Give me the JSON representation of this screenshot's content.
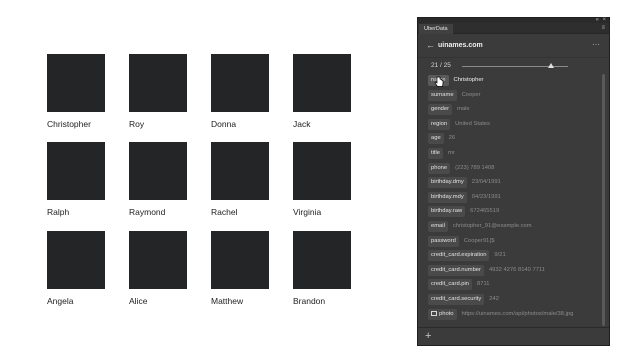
{
  "canvas": {
    "cards": [
      {
        "name": "Christopher"
      },
      {
        "name": "Roy"
      },
      {
        "name": "Donna"
      },
      {
        "name": "Jack"
      },
      {
        "name": "Ralph"
      },
      {
        "name": "Raymond"
      },
      {
        "name": "Rachel"
      },
      {
        "name": "Virginia"
      },
      {
        "name": "Angela"
      },
      {
        "name": "Alice"
      },
      {
        "name": "Matthew"
      },
      {
        "name": "Brandon"
      }
    ]
  },
  "panel": {
    "tab_label": "UberData",
    "site": "uinames.com",
    "pager": "21 / 25",
    "pager_fraction": 0.84,
    "fields": [
      {
        "key": "name",
        "value": "Christopher",
        "active": true
      },
      {
        "key": "surname",
        "value": "Cooper"
      },
      {
        "key": "gender",
        "value": "male"
      },
      {
        "key": "region",
        "value": "United States"
      },
      {
        "key": "age",
        "value": "26"
      },
      {
        "key": "title",
        "value": "mr"
      },
      {
        "key": "phone",
        "value": "(223) 789 1408"
      },
      {
        "key": "birthday.dmy",
        "value": "23/04/1991"
      },
      {
        "key": "birthday.mdy",
        "value": "04/23/1991"
      },
      {
        "key": "birthday.raw",
        "value": "672465519"
      },
      {
        "key": "email",
        "value": "christopher_91@example.com"
      },
      {
        "key": "password",
        "value": "Cooper91{$"
      },
      {
        "key": "credit_card.expiration",
        "value": "9/21"
      },
      {
        "key": "credit_card.number",
        "value": "4932 4276 8140 7711"
      },
      {
        "key": "credit_card.pin",
        "value": "8711"
      },
      {
        "key": "credit_card.security",
        "value": "242"
      },
      {
        "key": "photo",
        "value": "https://uinames.com/api/photos/male/38.jpg",
        "icon": "image-icon"
      }
    ]
  },
  "colors": {
    "panel_bg": "#3b3b3b",
    "swatch": "#242526"
  }
}
